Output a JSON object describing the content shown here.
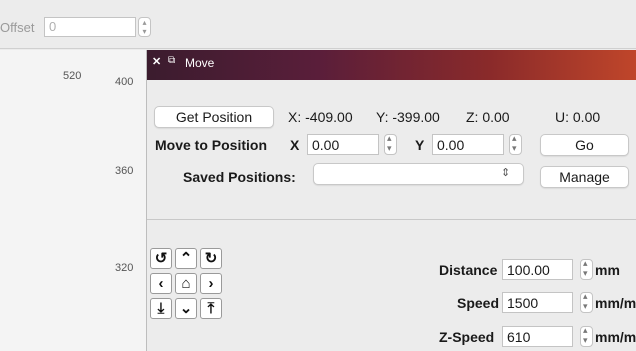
{
  "background": {
    "offset_label": "Offset",
    "offset_value": "0",
    "ruler_ticks": [
      "520",
      "400",
      "360",
      "320"
    ]
  },
  "window": {
    "title": "Move",
    "get_position_button": "Get Position",
    "position_readout": {
      "x": "X: -409.00",
      "y": "Y: -399.00",
      "z": "Z: 0.00",
      "u": "U: 0.00"
    },
    "move_to_position_label": "Move to Position",
    "x_label": "X",
    "x_value": "0.00",
    "y_label": "Y",
    "y_value": "0.00",
    "go_button": "Go",
    "saved_positions_label": "Saved Positions:",
    "saved_positions_value": "",
    "manage_button": "Manage",
    "distance_label": "Distance",
    "distance_value": "100.00",
    "distance_unit": "mm",
    "speed_label": "Speed",
    "speed_value": "1500",
    "speed_unit": "mm/m",
    "zspeed_label": "Z-Speed",
    "zspeed_value": "610",
    "zspeed_unit": "mm/m"
  },
  "jog_buttons": [
    {
      "icon": "rotate-ccw-icon",
      "glyph": "↺"
    },
    {
      "icon": "arrow-up-icon",
      "glyph": "⌃"
    },
    {
      "icon": "rotate-cw-icon",
      "glyph": "↻"
    },
    {
      "icon": "arrow-left-icon",
      "glyph": "‹"
    },
    {
      "icon": "home-icon",
      "glyph": "⌂"
    },
    {
      "icon": "arrow-right-icon",
      "glyph": "›"
    },
    {
      "icon": "z-down-icon",
      "glyph": "⤓"
    },
    {
      "icon": "arrow-down-icon",
      "glyph": "⌄"
    },
    {
      "icon": "z-up-icon",
      "glyph": "⤒"
    }
  ]
}
